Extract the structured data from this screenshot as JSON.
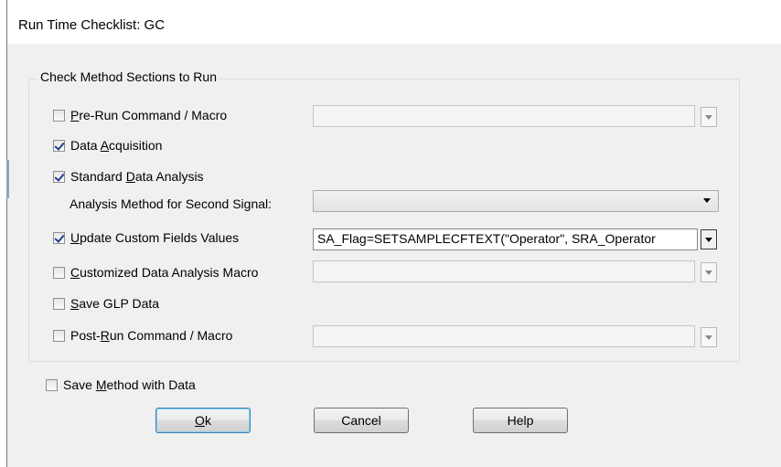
{
  "window": {
    "title": "Run Time Checklist: GC"
  },
  "group": {
    "title": "Check Method Sections to Run"
  },
  "options": {
    "pre_run": {
      "pre": "",
      "key": "P",
      "post": "re-Run Command / Macro",
      "checked": false,
      "dropdown_value": ""
    },
    "data_acq": {
      "pre": "Data ",
      "key": "A",
      "post": "cquisition",
      "checked": true
    },
    "std_analysis": {
      "pre": "Standard ",
      "key": "D",
      "post": "ata Analysis",
      "checked": true
    },
    "second_signal": {
      "label": "Analysis Method for Second Signal:",
      "dropdown_value": ""
    },
    "update_custom": {
      "pre": "",
      "key": "U",
      "post": "pdate Custom Fields Values",
      "checked": true,
      "dropdown_value": "SA_Flag=SETSAMPLECFTEXT(\"Operator\", SRA_Operator"
    },
    "custom_macro": {
      "pre": "",
      "key": "C",
      "post": "ustomized Data Analysis Macro",
      "checked": false,
      "dropdown_value": ""
    },
    "save_glp": {
      "pre": "",
      "key": "S",
      "post": "ave GLP Data",
      "checked": false
    },
    "post_run": {
      "pre": "Post-",
      "key": "R",
      "post": "un Command / Macro",
      "checked": false,
      "dropdown_value": ""
    }
  },
  "save_method": {
    "pre": "Save ",
    "key": "M",
    "post": "ethod with Data",
    "checked": false
  },
  "buttons": {
    "ok": {
      "pre": "",
      "key": "O",
      "post": "k"
    },
    "cancel": {
      "label": "Cancel"
    },
    "help": {
      "label": "Help"
    }
  }
}
